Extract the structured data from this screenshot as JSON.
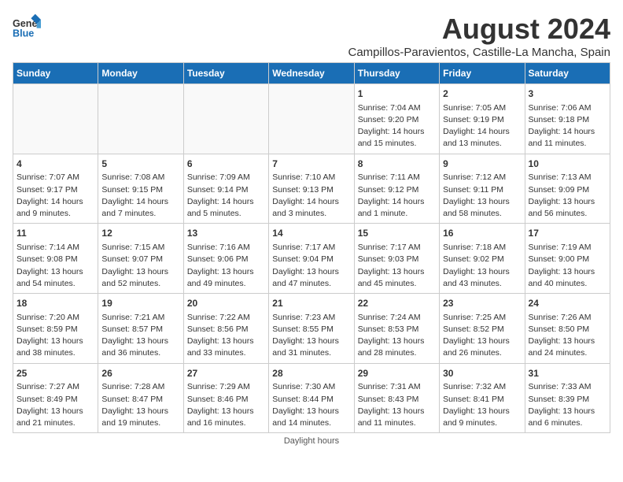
{
  "header": {
    "logo_line1": "General",
    "logo_line2": "Blue",
    "main_title": "August 2024",
    "subtitle": "Campillos-Paravientos, Castille-La Mancha, Spain"
  },
  "weekdays": [
    "Sunday",
    "Monday",
    "Tuesday",
    "Wednesday",
    "Thursday",
    "Friday",
    "Saturday"
  ],
  "weeks": [
    [
      {
        "day": "",
        "info": ""
      },
      {
        "day": "",
        "info": ""
      },
      {
        "day": "",
        "info": ""
      },
      {
        "day": "",
        "info": ""
      },
      {
        "day": "1",
        "info": "Sunrise: 7:04 AM\nSunset: 9:20 PM\nDaylight: 14 hours\nand 15 minutes."
      },
      {
        "day": "2",
        "info": "Sunrise: 7:05 AM\nSunset: 9:19 PM\nDaylight: 14 hours\nand 13 minutes."
      },
      {
        "day": "3",
        "info": "Sunrise: 7:06 AM\nSunset: 9:18 PM\nDaylight: 14 hours\nand 11 minutes."
      }
    ],
    [
      {
        "day": "4",
        "info": "Sunrise: 7:07 AM\nSunset: 9:17 PM\nDaylight: 14 hours\nand 9 minutes."
      },
      {
        "day": "5",
        "info": "Sunrise: 7:08 AM\nSunset: 9:15 PM\nDaylight: 14 hours\nand 7 minutes."
      },
      {
        "day": "6",
        "info": "Sunrise: 7:09 AM\nSunset: 9:14 PM\nDaylight: 14 hours\nand 5 minutes."
      },
      {
        "day": "7",
        "info": "Sunrise: 7:10 AM\nSunset: 9:13 PM\nDaylight: 14 hours\nand 3 minutes."
      },
      {
        "day": "8",
        "info": "Sunrise: 7:11 AM\nSunset: 9:12 PM\nDaylight: 14 hours\nand 1 minute."
      },
      {
        "day": "9",
        "info": "Sunrise: 7:12 AM\nSunset: 9:11 PM\nDaylight: 13 hours\nand 58 minutes."
      },
      {
        "day": "10",
        "info": "Sunrise: 7:13 AM\nSunset: 9:09 PM\nDaylight: 13 hours\nand 56 minutes."
      }
    ],
    [
      {
        "day": "11",
        "info": "Sunrise: 7:14 AM\nSunset: 9:08 PM\nDaylight: 13 hours\nand 54 minutes."
      },
      {
        "day": "12",
        "info": "Sunrise: 7:15 AM\nSunset: 9:07 PM\nDaylight: 13 hours\nand 52 minutes."
      },
      {
        "day": "13",
        "info": "Sunrise: 7:16 AM\nSunset: 9:06 PM\nDaylight: 13 hours\nand 49 minutes."
      },
      {
        "day": "14",
        "info": "Sunrise: 7:17 AM\nSunset: 9:04 PM\nDaylight: 13 hours\nand 47 minutes."
      },
      {
        "day": "15",
        "info": "Sunrise: 7:17 AM\nSunset: 9:03 PM\nDaylight: 13 hours\nand 45 minutes."
      },
      {
        "day": "16",
        "info": "Sunrise: 7:18 AM\nSunset: 9:02 PM\nDaylight: 13 hours\nand 43 minutes."
      },
      {
        "day": "17",
        "info": "Sunrise: 7:19 AM\nSunset: 9:00 PM\nDaylight: 13 hours\nand 40 minutes."
      }
    ],
    [
      {
        "day": "18",
        "info": "Sunrise: 7:20 AM\nSunset: 8:59 PM\nDaylight: 13 hours\nand 38 minutes."
      },
      {
        "day": "19",
        "info": "Sunrise: 7:21 AM\nSunset: 8:57 PM\nDaylight: 13 hours\nand 36 minutes."
      },
      {
        "day": "20",
        "info": "Sunrise: 7:22 AM\nSunset: 8:56 PM\nDaylight: 13 hours\nand 33 minutes."
      },
      {
        "day": "21",
        "info": "Sunrise: 7:23 AM\nSunset: 8:55 PM\nDaylight: 13 hours\nand 31 minutes."
      },
      {
        "day": "22",
        "info": "Sunrise: 7:24 AM\nSunset: 8:53 PM\nDaylight: 13 hours\nand 28 minutes."
      },
      {
        "day": "23",
        "info": "Sunrise: 7:25 AM\nSunset: 8:52 PM\nDaylight: 13 hours\nand 26 minutes."
      },
      {
        "day": "24",
        "info": "Sunrise: 7:26 AM\nSunset: 8:50 PM\nDaylight: 13 hours\nand 24 minutes."
      }
    ],
    [
      {
        "day": "25",
        "info": "Sunrise: 7:27 AM\nSunset: 8:49 PM\nDaylight: 13 hours\nand 21 minutes."
      },
      {
        "day": "26",
        "info": "Sunrise: 7:28 AM\nSunset: 8:47 PM\nDaylight: 13 hours\nand 19 minutes."
      },
      {
        "day": "27",
        "info": "Sunrise: 7:29 AM\nSunset: 8:46 PM\nDaylight: 13 hours\nand 16 minutes."
      },
      {
        "day": "28",
        "info": "Sunrise: 7:30 AM\nSunset: 8:44 PM\nDaylight: 13 hours\nand 14 minutes."
      },
      {
        "day": "29",
        "info": "Sunrise: 7:31 AM\nSunset: 8:43 PM\nDaylight: 13 hours\nand 11 minutes."
      },
      {
        "day": "30",
        "info": "Sunrise: 7:32 AM\nSunset: 8:41 PM\nDaylight: 13 hours\nand 9 minutes."
      },
      {
        "day": "31",
        "info": "Sunrise: 7:33 AM\nSunset: 8:39 PM\nDaylight: 13 hours\nand 6 minutes."
      }
    ]
  ],
  "footer": {
    "note": "Daylight hours"
  }
}
